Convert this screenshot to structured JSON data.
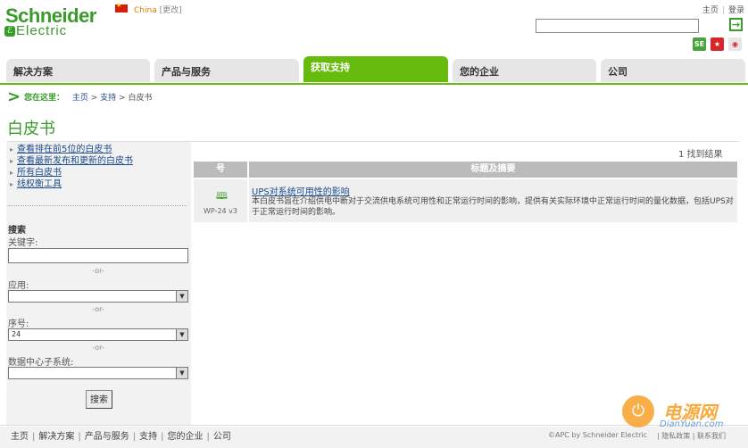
{
  "header": {
    "logo_line1": "Schneider",
    "logo_line2": "Electric",
    "country": "China",
    "change_link": "[更改]",
    "top_links": [
      "主页",
      "登录"
    ],
    "search_placeholder": ""
  },
  "nav": {
    "tabs": [
      "解决方案",
      "产品与服务",
      "获取支持",
      "您的企业",
      "公司"
    ],
    "active_tab": "获取支持"
  },
  "breadcrumb": {
    "label": "您在这里：",
    "items": [
      "主页",
      "支持",
      "白皮书"
    ]
  },
  "page_title": "白皮书",
  "sidebar": {
    "links": [
      "查看排在前5位的白皮书",
      "查看最新发布和更新的白皮书",
      "所有白皮书",
      "线权衡工具"
    ],
    "search_title": "搜索",
    "keyword_label": "关键字:",
    "keyword_value": "",
    "or_text": "-or-",
    "application_label": "应用:",
    "application_value": "",
    "serial_label": "序号:",
    "serial_value": "24",
    "subsystem_label": "数据中心子系统:",
    "subsystem_value": "",
    "search_button": "搜索"
  },
  "results": {
    "count_text": "1 找到结果",
    "col_number": "号",
    "col_title": "标题及摘要",
    "rows": [
      {
        "id": "WP-24 v3",
        "title": "UPS对系统可用性的影响",
        "description": "本白皮书旨在介绍供电中断对于交流供电系统可用性和正常运行时间的影响，提供有关实际环境中正常运行时间的量化数据，包括UPS对于正常运行时间的影响。"
      }
    ]
  },
  "footer": {
    "links": [
      "主页",
      "解决方案",
      "产品与服务",
      "支持",
      "您的企业",
      "公司"
    ],
    "copyright": "©APC by Schneider Electric",
    "right_links": [
      "隐私政策",
      "联系我们"
    ]
  },
  "watermark": {
    "cn": "电源网",
    "url": "DianYuan.com"
  },
  "colors": {
    "brand_green": "#3a9a2a",
    "active_tab": "#67bb0f",
    "link_blue": "#1a4a8a",
    "table_header": "#bbbbbb"
  },
  "icons": [
    "flag-icon",
    "search-go-icon",
    "share-icon",
    "favorite-icon",
    "weibo-icon",
    "breadcrumb-arrow-icon",
    "book-icon",
    "select-arrow-icon"
  ]
}
